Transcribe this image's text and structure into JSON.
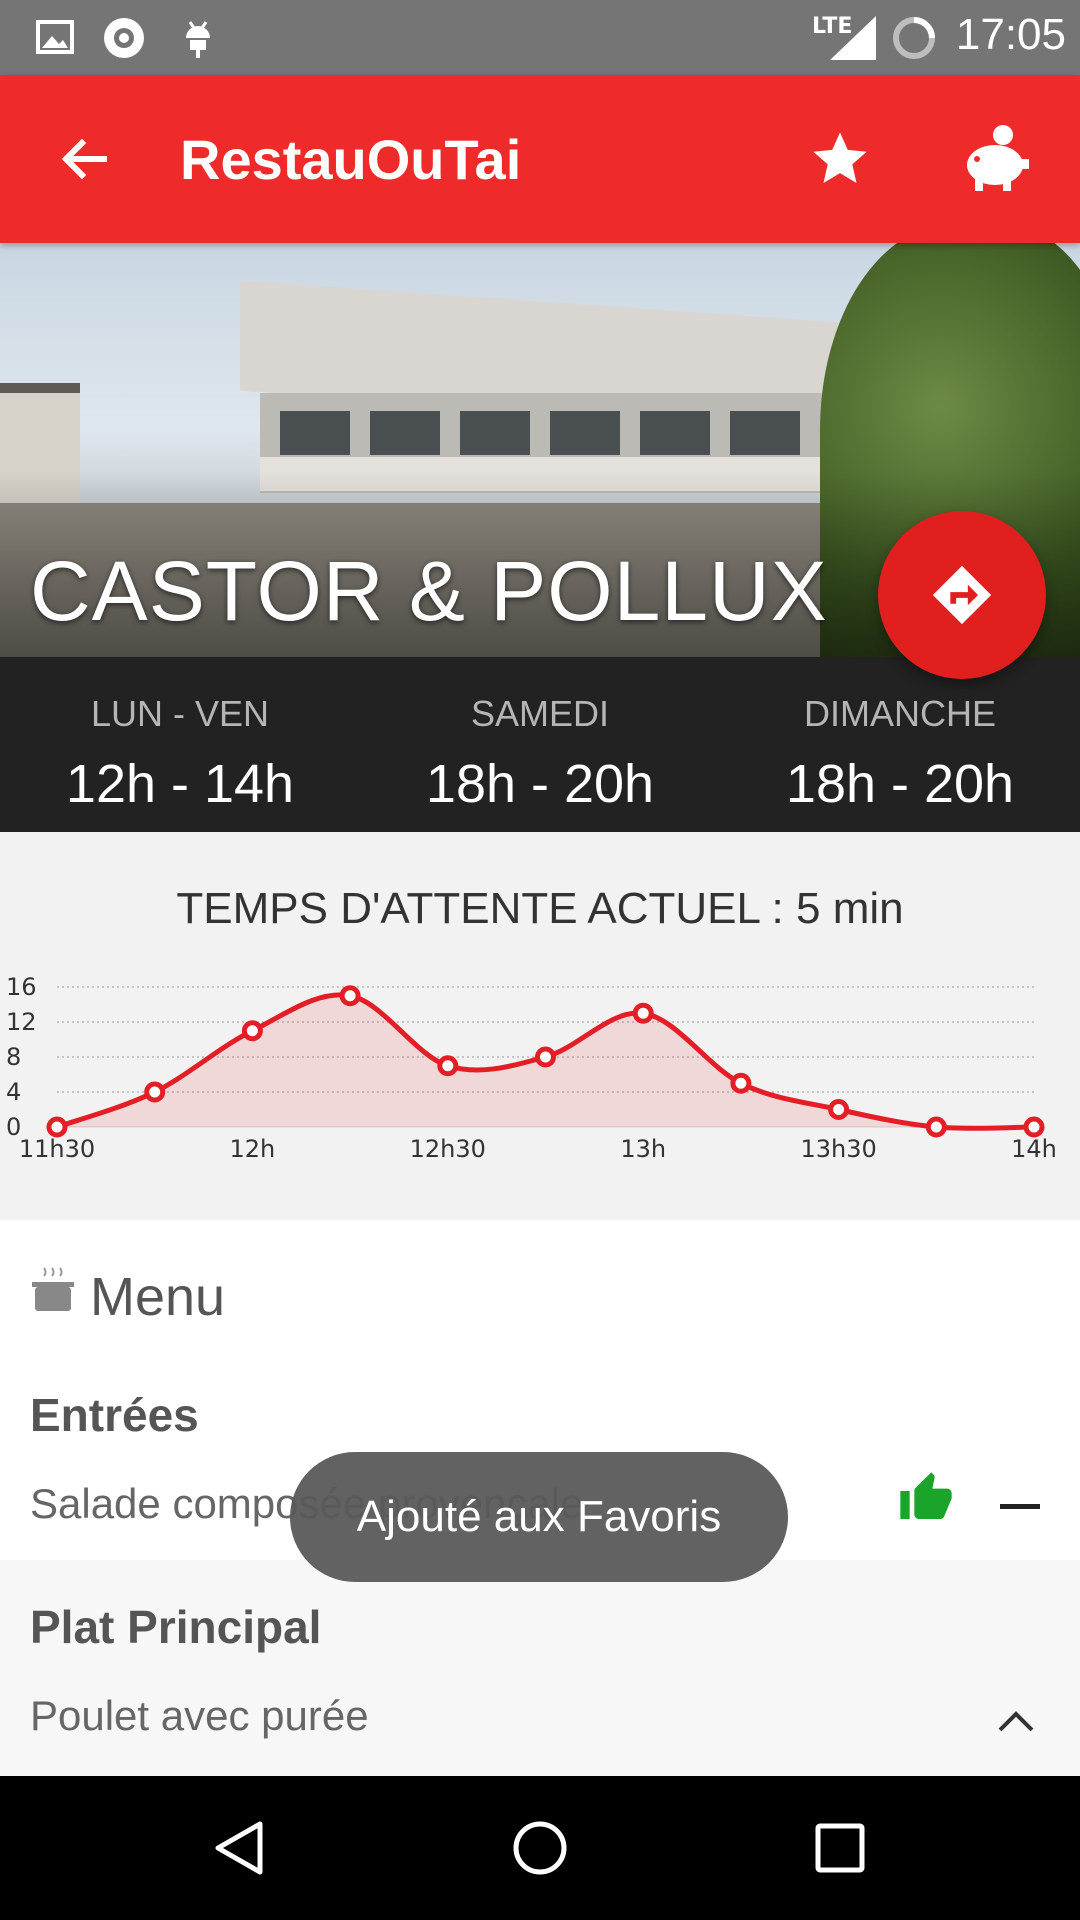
{
  "status_bar": {
    "time": "17:05",
    "network": "LTE",
    "icons": [
      "image-icon",
      "signal-app-icon",
      "android-debug-icon",
      "lte-signal-icon",
      "sync-icon"
    ]
  },
  "app_bar": {
    "title": "RestauOuTai",
    "back_icon": "arrow-back-icon",
    "actions": [
      "star-icon",
      "piggy-bank-icon"
    ],
    "color": "#ee2a2a"
  },
  "restaurant": {
    "name": "CASTOR & POLLUX",
    "directions_icon": "directions-icon"
  },
  "hours": [
    {
      "day": "LUN - VEN",
      "hours": "12h - 14h"
    },
    {
      "day": "SAMEDI",
      "hours": "18h - 20h"
    },
    {
      "day": "DIMANCHE",
      "hours": "18h - 20h"
    }
  ],
  "wait": {
    "title": "TEMPS D'ATTENTE ACTUEL : 5 min"
  },
  "chart_data": {
    "type": "line",
    "x": [
      "11h30",
      "11h45",
      "12h",
      "12h15",
      "12h30",
      "12h45",
      "13h",
      "13h15",
      "13h30",
      "13h45",
      "14h"
    ],
    "x_tick_labels": [
      "11h30",
      "12h",
      "12h30",
      "13h",
      "13h30",
      "14h"
    ],
    "series": [
      {
        "values": [
          0,
          4,
          11,
          15,
          7,
          8,
          13,
          5,
          2,
          0,
          0
        ]
      }
    ],
    "y_ticks": [
      0,
      4,
      8,
      12,
      16
    ],
    "ylim": [
      0,
      16
    ],
    "grid": true,
    "fill": "area",
    "color": "#e41e26"
  },
  "menu": {
    "title": "Menu",
    "sections": [
      {
        "title": "Entrées",
        "items": [
          "Salade composée provençale"
        ]
      },
      {
        "title": "Plat Principal",
        "items": [
          "Poulet avec purée"
        ]
      }
    ]
  },
  "toast": {
    "text": "Ajouté aux Favoris"
  },
  "nav_bar": {
    "buttons": [
      "back-icon",
      "home-icon",
      "recents-icon"
    ]
  }
}
